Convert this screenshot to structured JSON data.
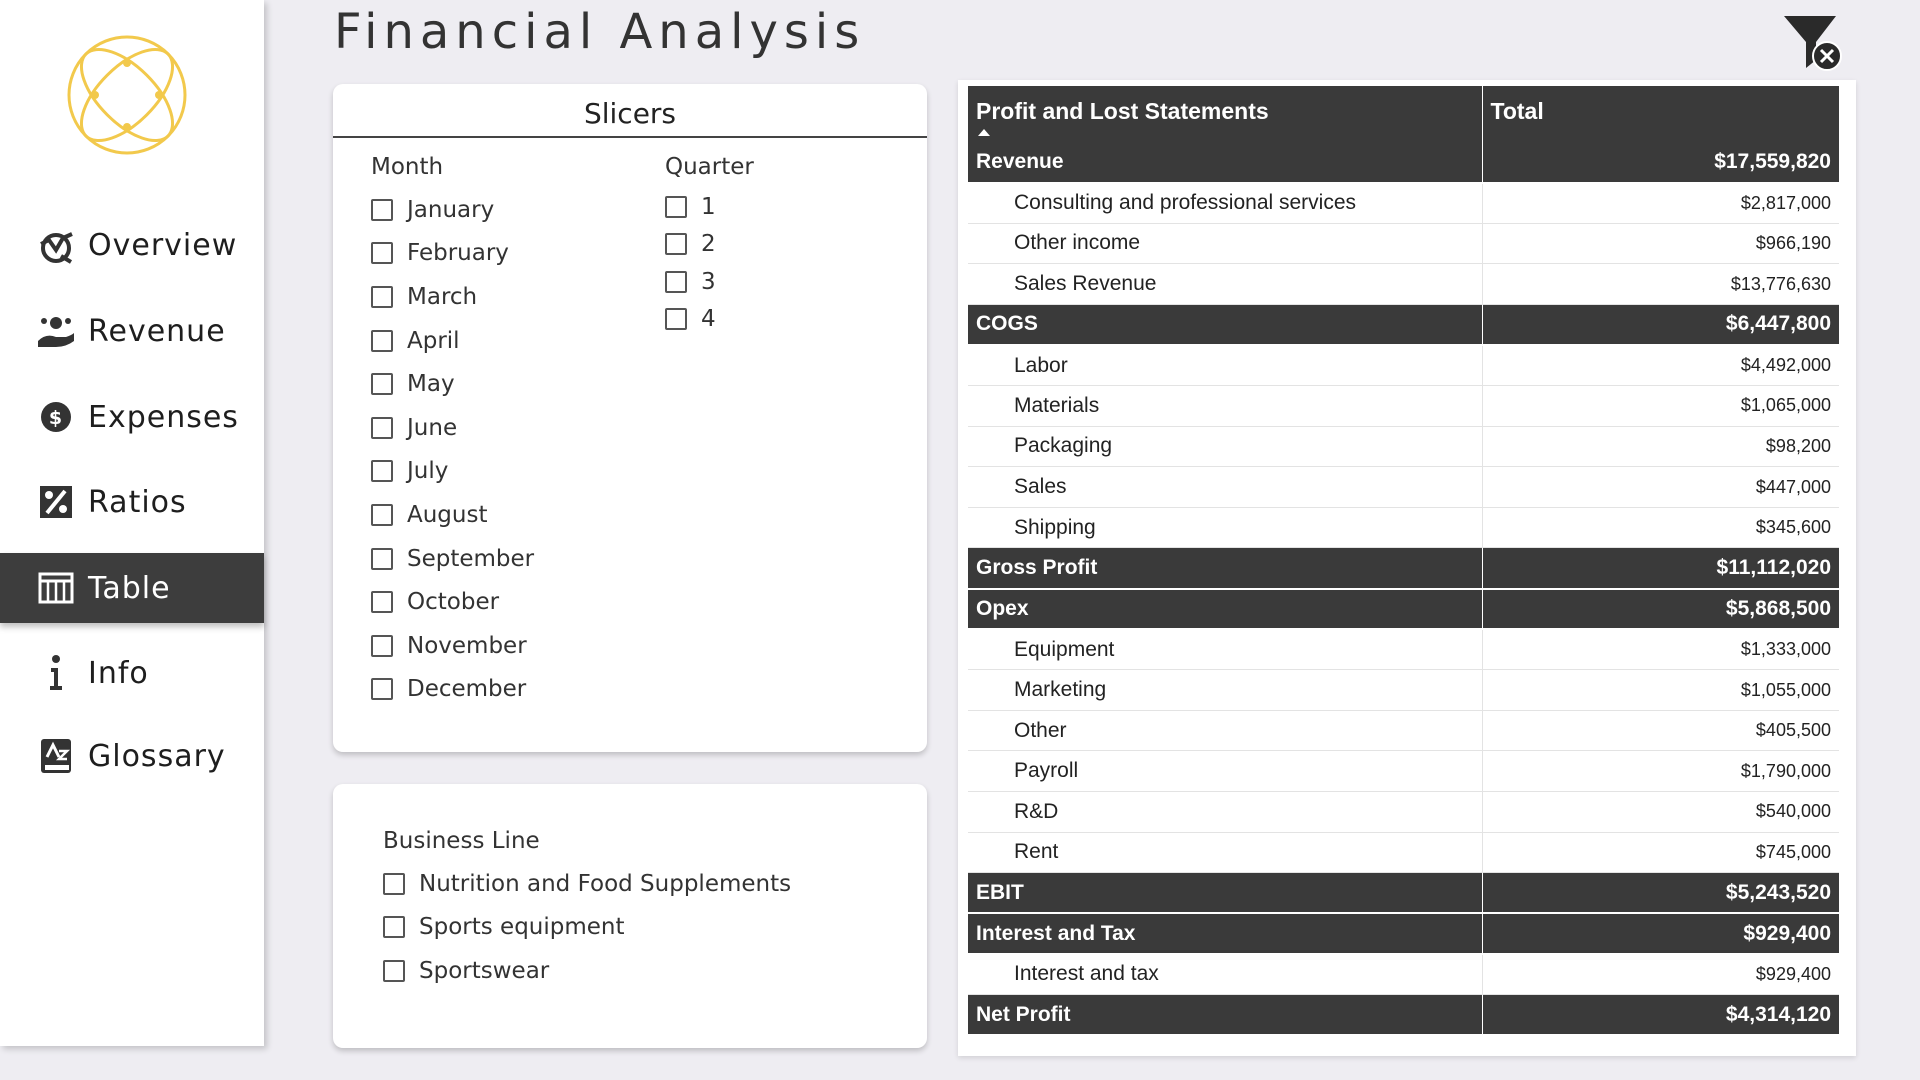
{
  "header": {
    "title": "Financial Analysis"
  },
  "sidebar": {
    "items": [
      {
        "label": "Overview",
        "icon": "overview-icon",
        "active": false
      },
      {
        "label": "Revenue",
        "icon": "revenue-icon",
        "active": false
      },
      {
        "label": "Expenses",
        "icon": "expenses-icon",
        "active": false
      },
      {
        "label": "Ratios",
        "icon": "ratios-icon",
        "active": false
      },
      {
        "label": "Table",
        "icon": "table-icon",
        "active": true
      },
      {
        "label": "Info",
        "icon": "info-icon",
        "active": false
      },
      {
        "label": "Glossary",
        "icon": "glossary-icon",
        "active": false
      }
    ]
  },
  "slicers": {
    "title": "Slicers",
    "month": {
      "title": "Month",
      "options": [
        "January",
        "February",
        "March",
        "April",
        "May",
        "June",
        "July",
        "August",
        "September",
        "October",
        "November",
        "December"
      ]
    },
    "quarter": {
      "title": "Quarter",
      "options": [
        "1",
        "2",
        "3",
        "4"
      ]
    },
    "business_line": {
      "title": "Business Line",
      "options": [
        "Nutrition and Food Supplements",
        "Sports equipment",
        "Sportswear"
      ]
    }
  },
  "table": {
    "columns": [
      "Profit and Lost Statements",
      "Total"
    ],
    "rows": [
      {
        "type": "group",
        "label": "Revenue",
        "value": "$17,559,820"
      },
      {
        "type": "detail",
        "label": "Consulting and professional services",
        "value": "$2,817,000"
      },
      {
        "type": "detail",
        "label": "Other income",
        "value": "$966,190"
      },
      {
        "type": "detail",
        "label": "Sales Revenue",
        "value": "$13,776,630"
      },
      {
        "type": "group",
        "label": "COGS",
        "value": "$6,447,800"
      },
      {
        "type": "detail",
        "label": "Labor",
        "value": "$4,492,000"
      },
      {
        "type": "detail",
        "label": "Materials",
        "value": "$1,065,000"
      },
      {
        "type": "detail",
        "label": "Packaging",
        "value": "$98,200"
      },
      {
        "type": "detail",
        "label": "Sales",
        "value": "$447,000"
      },
      {
        "type": "detail",
        "label": "Shipping",
        "value": "$345,600"
      },
      {
        "type": "group",
        "label": "Gross Profit",
        "value": "$11,112,020"
      },
      {
        "type": "group",
        "label": "Opex",
        "value": "$5,868,500"
      },
      {
        "type": "detail",
        "label": "Equipment",
        "value": "$1,333,000"
      },
      {
        "type": "detail",
        "label": "Marketing",
        "value": "$1,055,000"
      },
      {
        "type": "detail",
        "label": "Other",
        "value": "$405,500"
      },
      {
        "type": "detail",
        "label": "Payroll",
        "value": "$1,790,000"
      },
      {
        "type": "detail",
        "label": "R&D",
        "value": "$540,000"
      },
      {
        "type": "detail",
        "label": "Rent",
        "value": "$745,000"
      },
      {
        "type": "group",
        "label": "EBIT",
        "value": "$5,243,520"
      },
      {
        "type": "group",
        "label": "Interest and Tax",
        "value": "$929,400"
      },
      {
        "type": "detail",
        "label": "Interest and tax",
        "value": "$929,400"
      },
      {
        "type": "group",
        "label": "Net Profit",
        "value": "$4,314,120"
      }
    ]
  },
  "colors": {
    "accent_gold": "#f2c94c",
    "dark": "#3a3a3a",
    "background": "#eeedf2"
  }
}
